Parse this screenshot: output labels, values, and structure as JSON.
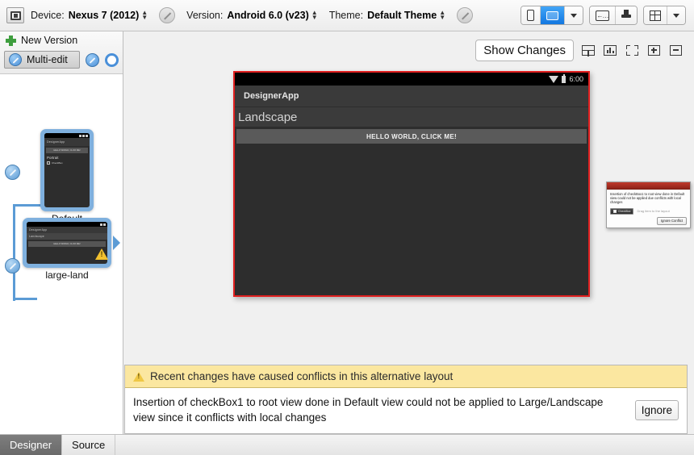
{
  "toolbar": {
    "device_icon": "device-icon",
    "device_label": "Device:",
    "device_value": "Nexus 7 (2012)",
    "version_label": "Version:",
    "version_value": "Android 6.0 (v23)",
    "theme_label": "Theme:",
    "theme_value": "Default Theme",
    "icons": {
      "phone": "phone-portrait-icon",
      "tablet": "tablet-landscape-icon",
      "orientation_dropdown": "chevron-down-icon",
      "locale": "locale-icon",
      "theme_brush": "paintbrush-icon",
      "activity": "activity-grid-icon",
      "activity_dropdown": "chevron-down-icon"
    }
  },
  "sidebar": {
    "new_version_label": "New Version",
    "multi_edit_label": "Multi-edit",
    "configs": [
      {
        "label": "Default",
        "has_warning": false
      },
      {
        "label": "large-land",
        "has_warning": true
      }
    ],
    "default_preview": {
      "app_title": "DesignerApp",
      "button_text": "HELLO WORLD, CLICK ME!",
      "body_text": "Portrait",
      "checkbox_label": "CheckBox"
    },
    "land_preview": {
      "app_title": "DesignerApp",
      "title_text": "Landscape",
      "button_text": "HELLO WORLD, CLICK ME!"
    }
  },
  "main_toolbar": {
    "show_changes_label": "Show Changes",
    "icons": {
      "split": "split-view-icon",
      "render": "render-stats-icon",
      "fullscreen": "fullscreen-icon",
      "zoom_in": "zoom-in-icon",
      "zoom_out": "zoom-out-icon"
    }
  },
  "preview": {
    "status_time": "6:00",
    "status_icons": {
      "wifi": "wifi-icon",
      "battery": "battery-icon"
    },
    "app_bar_title": "DesignerApp",
    "layout_title": "Landscape",
    "button_text": "HELLO WORLD, CLICK ME!"
  },
  "conflict_popup": {
    "message": "Insertion of checkBox1 to root view done in Default view could not be applied due conflicts with local changes",
    "chip_label": "CheckBox",
    "drag_hint": "Drag item to the layout",
    "button_label": "Ignore Conflict"
  },
  "notification": {
    "warning_icon": "warning-triangle-icon",
    "headline": "Recent changes have caused conflicts in this alternative layout",
    "detail": "Insertion of checkBox1 to root view done in Default view could not be applied to Large/Landscape view since it conflicts with local changes",
    "ignore_label": "Ignore"
  },
  "bottom_tabs": [
    {
      "label": "Designer",
      "active": true
    },
    {
      "label": "Source",
      "active": false
    }
  ],
  "colors": {
    "accent_blue": "#1277e0",
    "selection_red": "#e01f1f",
    "warning_yellow": "#fbe7a0",
    "node_blue": "#5b9bd5"
  }
}
